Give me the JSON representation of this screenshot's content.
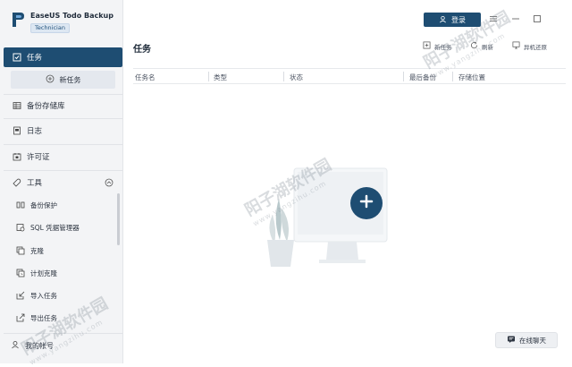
{
  "app": {
    "name": "EaseUS Todo Backup",
    "edition": "Technician"
  },
  "sidebar": {
    "items": [
      {
        "label": "任务",
        "icon": "task-check-icon",
        "active": true
      },
      {
        "label": "备份存储库",
        "icon": "repository-icon"
      },
      {
        "label": "日志",
        "icon": "log-icon"
      },
      {
        "label": "许可证",
        "icon": "license-icon"
      },
      {
        "label": "工具",
        "icon": "tools-icon"
      }
    ],
    "new_task": "新任务",
    "tools": [
      {
        "label": "备份保护",
        "icon": "backup-protect-icon"
      },
      {
        "label": "SQL 凭据管理器",
        "icon": "sql-credential-icon"
      },
      {
        "label": "克隆",
        "icon": "clone-icon"
      },
      {
        "label": "计划克隆",
        "icon": "schedule-clone-icon"
      },
      {
        "label": "导入任务",
        "icon": "import-icon"
      },
      {
        "label": "导出任务",
        "icon": "export-icon"
      }
    ],
    "account": "我的帐号"
  },
  "header": {
    "login": "登录"
  },
  "main": {
    "title": "任务",
    "toolbar": {
      "new_task": "新任务",
      "refresh": "刷新",
      "bare_metal_restore": "异机还原"
    },
    "columns": [
      "任务名",
      "类型",
      "状态",
      "最后备份",
      "存储位置"
    ],
    "chat": "在线聊天"
  },
  "watermark": {
    "text": "阳子湖软件园",
    "url": "www.yangzihu.com"
  },
  "colors": {
    "accent": "#1e4d72",
    "sidebar_bg": "#f3f4f6"
  }
}
